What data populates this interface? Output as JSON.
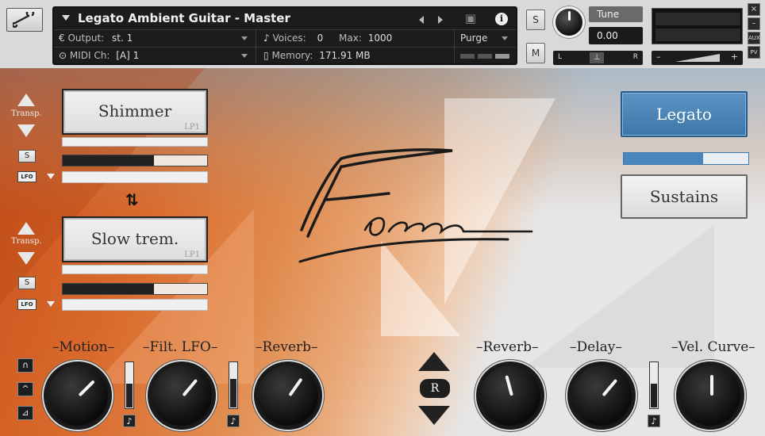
{
  "header": {
    "instrument_name": "Legato Ambient Guitar - Master",
    "output_label": "Output:",
    "output_value": "st. 1",
    "voices_label": "Voices:",
    "voices_value": "0",
    "max_label": "Max:",
    "max_value": "1000",
    "purge_label": "Purge",
    "midi_label": "MIDI Ch:",
    "midi_value": "[A]  1",
    "memory_label": "Memory:",
    "memory_value": "171.91 MB",
    "s_label": "S",
    "m_label": "M",
    "tune_label": "Tune",
    "tune_value": "0.00",
    "pan_left": "L",
    "pan_right": "R",
    "vol_minus": "–",
    "vol_plus": "+",
    "side_close": "×",
    "side_min": "–",
    "side_aux": "AUX",
    "side_pv": "PV"
  },
  "layers": [
    {
      "transp_label": "Transp.",
      "s_label": "S",
      "lfo_label": "LFO",
      "preset_name": "Shimmer",
      "preset_tag": "LP1",
      "level": 0.63
    },
    {
      "transp_label": "Transp.",
      "s_label": "S",
      "lfo_label": "LFO",
      "preset_name": "Slow trem.",
      "preset_tag": "LP1",
      "level": 0.63
    }
  ],
  "swap_icon": "up-down-arrows",
  "articulations": {
    "legato_label": "Legato",
    "legato_level": 0.64,
    "sustains_label": "Sustains"
  },
  "knobs_left": [
    {
      "label": "–Motion–",
      "angle": 225
    },
    {
      "label": "–Filt. LFO–",
      "angle": 220
    },
    {
      "label": "–Reverb–",
      "angle": 215
    }
  ],
  "knobs_right": [
    {
      "label": "–Reverb–",
      "angle": 165
    },
    {
      "label": "–Delay–",
      "angle": 220
    },
    {
      "label": "–Vel. Curve–",
      "angle": 180
    }
  ],
  "meters": {
    "motion": 0.55,
    "filt_lfo": 0.65,
    "delay": 0.55
  },
  "note_symbol": "♪",
  "mode_buttons": [
    "∩",
    "^",
    "⊿"
  ],
  "r_label": "R",
  "colors": {
    "accent": "#4a86bb",
    "warm": "#d96a2c"
  }
}
